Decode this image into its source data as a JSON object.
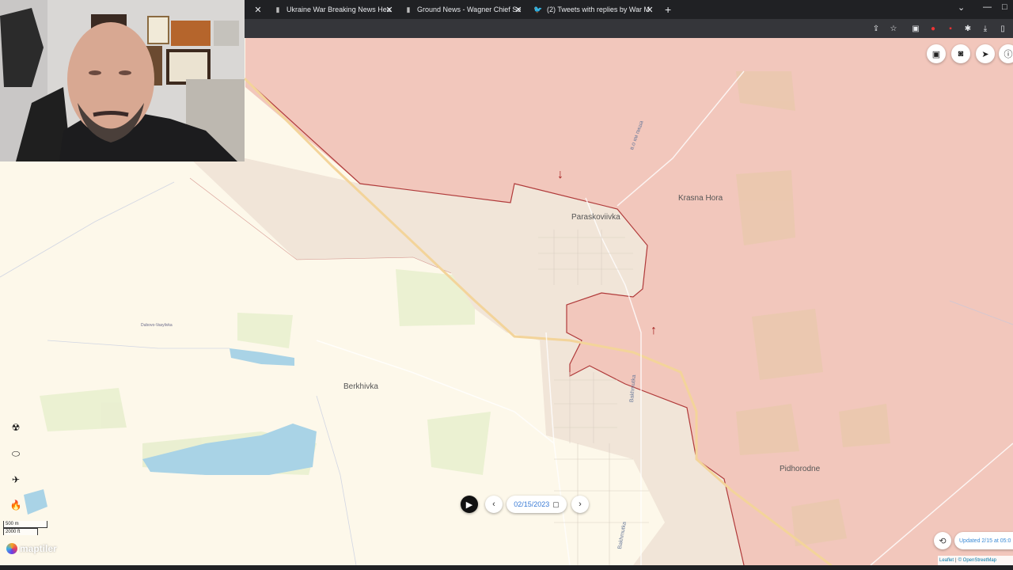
{
  "browser": {
    "tabs": [
      {
        "title": "Ukraine War Breaking News Hea",
        "icon": "bookmark-icon"
      },
      {
        "title": "Ground News - Wagner Chief Se",
        "icon": "bookmark-icon"
      },
      {
        "title": "(2) Tweets with replies by War M",
        "icon": "twitter-icon"
      }
    ],
    "new_tab": "+",
    "close": "✕"
  },
  "map": {
    "places": {
      "paraskoviivka": "Paraskoviivka",
      "krasna_hora": "Krasna Hora",
      "berkhivka": "Berkhivka",
      "pidhorodne": "Pidhorodne",
      "dubovo": "Dubovo-Vasylivka"
    },
    "roads": {
      "bakhmutka_1": "Bakhmutka",
      "bakhmutka_2": "Bakhmutka",
      "road_top": "в.о км пиша"
    },
    "colors": {
      "occupied": "#f2c7bc",
      "contested": "#f1e5d8",
      "base": "#fdf8ea",
      "front_line": "#b03a3a"
    }
  },
  "controls": {
    "date": "02/15/2023",
    "updated": "Updated 2/15 at 05:0",
    "attribution_leaflet": "Leaflet",
    "attribution_osm": "© OpenStreetMap",
    "scale_metric": "500 m",
    "scale_imperial": "2000 ft",
    "maptiler": "maptiler"
  }
}
